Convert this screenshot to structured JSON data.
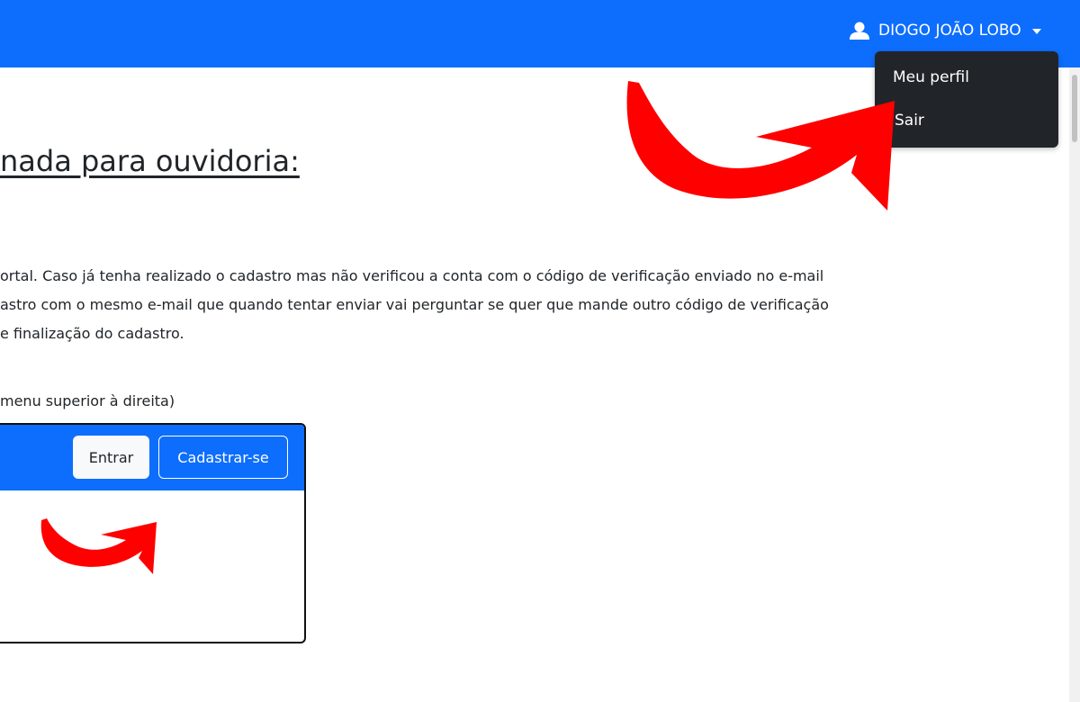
{
  "navbar": {
    "user_name": "DIOGO JOÃO LOBO",
    "user_icon": "user-icon",
    "caret_icon": "caret-down-icon"
  },
  "dropdown": {
    "items": [
      {
        "label": "Meu perfil"
      },
      {
        "label": "Sair"
      }
    ]
  },
  "main": {
    "heading": "nada para ouvidoria:",
    "paragraph_lines": [
      "ortal. Caso já tenha realizado o cadastro mas não verificou a conta com o código de verificação enviado no e-mail",
      "astro com o mesmo e-mail que quando tentar enviar vai perguntar se quer que mande outro código de verificação",
      "e finalização do cadastro."
    ],
    "caption": " menu superior à direita)",
    "example": {
      "login_label": "Entrar",
      "register_label": "Cadastrar-se"
    }
  },
  "annotations": {
    "arrow_icon": "curved-arrow-icon",
    "arrow_color": "#ff0000"
  },
  "colors": {
    "primary": "#0d6efd",
    "dropdown_bg": "#212529",
    "text": "#212529"
  }
}
